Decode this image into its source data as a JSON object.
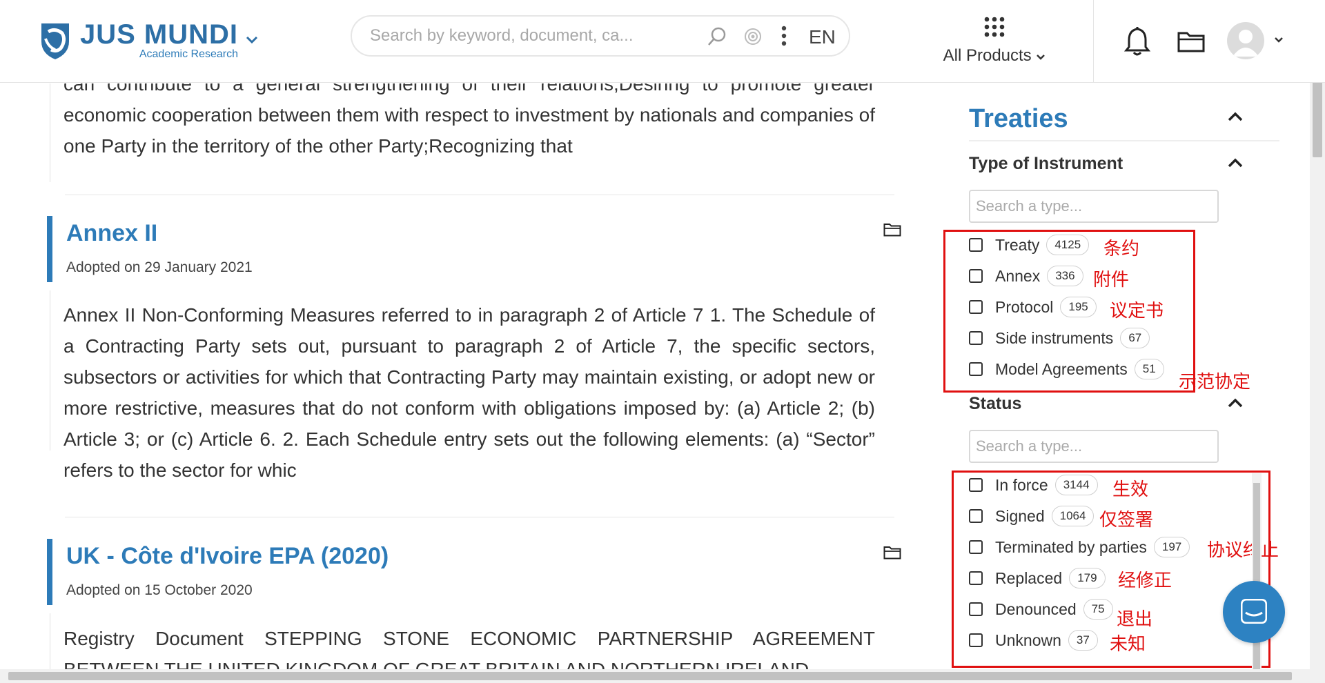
{
  "header": {
    "logo_title": "JUS MUNDI",
    "logo_subtitle": "Academic Research",
    "search_placeholder": "Search by keyword, document, ca...",
    "language": "EN",
    "products_label": "All Products"
  },
  "results": [
    {
      "excerpt": "can contribute to a general strengthening of their relations;Desiring to promote greater economic cooperation between them with respect to investment by nationals and companies of one Party in the territory of the other Party;Recognizing that"
    },
    {
      "title": "Annex II",
      "date": "Adopted on 29 January 2021",
      "excerpt": "Annex II Non-Conforming Measures referred to in paragraph 2 of Article 7 1. The Schedule of a Contracting Party sets out, pursuant to paragraph 2 of Article 7, the specific sectors, subsectors or activities for which that Contracting Party may maintain existing, or adopt new or more restrictive, measures that do not conform with obligations imposed by: (a) Article 2; (b) Article 3; or (c) Article 6. 2. Each Schedule entry sets out the following elements: (a) “Sector” refers to the sector for whic"
    },
    {
      "title": "UK - Côte d'Ivoire EPA (2020)",
      "date": "Adopted on 15 October 2020",
      "excerpt": "Registry Document STEPPING STONE ECONOMIC PARTNERSHIP AGREEMENT BETWEEN THE UNITED KINGDOM OF GREAT BRITAIN AND NORTHERN IRELAND"
    }
  ],
  "filters": {
    "title": "Treaties",
    "type_section": {
      "title": "Type of Instrument",
      "search_placeholder": "Search a type...",
      "options": [
        {
          "label": "Treaty",
          "count": "4125",
          "note": "条约"
        },
        {
          "label": "Annex",
          "count": "336",
          "note": "附件"
        },
        {
          "label": "Protocol",
          "count": "195",
          "note": "议定书"
        },
        {
          "label": "Side instruments",
          "count": "67",
          "note": ""
        },
        {
          "label": "Model Agreements",
          "count": "51",
          "note": "示范协定"
        }
      ]
    },
    "status_section": {
      "title": "Status",
      "search_placeholder": "Search a type...",
      "options": [
        {
          "label": "In force",
          "count": "3144",
          "note": "生效"
        },
        {
          "label": "Signed",
          "count": "1064",
          "note": "仅签署"
        },
        {
          "label": "Terminated by parties",
          "count": "197",
          "note": "协议终止"
        },
        {
          "label": "Replaced",
          "count": "179",
          "note": "经修正"
        },
        {
          "label": "Denounced",
          "count": "75",
          "note": "退出"
        },
        {
          "label": "Unknown",
          "count": "37",
          "note": "未知"
        }
      ]
    }
  },
  "colors": {
    "brand": "#2d7bb8",
    "annotation": "#e01010"
  }
}
